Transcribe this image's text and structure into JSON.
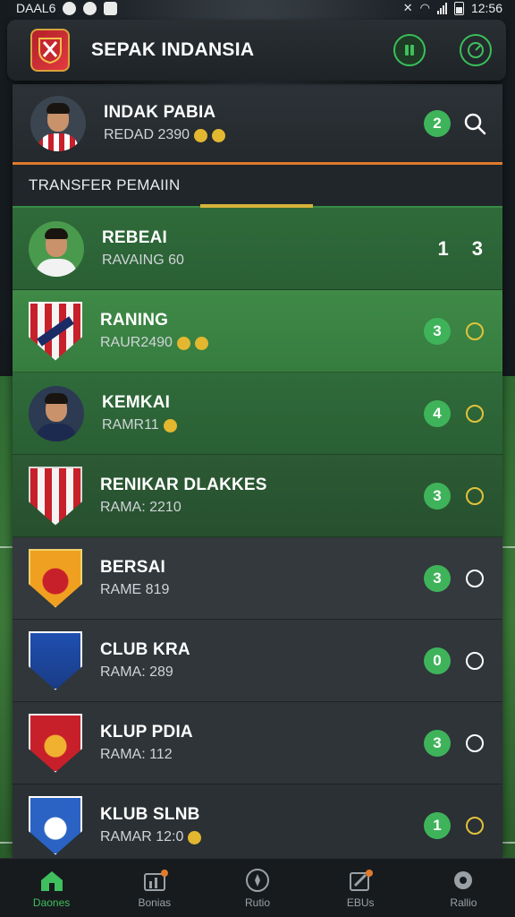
{
  "status_bar": {
    "carrier": "DAAL6",
    "time": "12:56"
  },
  "app": {
    "title": "SEPAK INDANSIA"
  },
  "featured": {
    "name": "INDAK PABIA",
    "sub": "REDAD 2390",
    "badge": "2"
  },
  "section": {
    "title": "TRANSFER PEMAIIN"
  },
  "rows": [
    {
      "name": "REBEAI",
      "sub": "RAVAING 60",
      "badge": "1",
      "action_text": "3",
      "kind": "player",
      "highlight": "green"
    },
    {
      "name": "RANING",
      "sub": "RAUR2490",
      "badge": "3",
      "kind": "crest",
      "highlight": "bright"
    },
    {
      "name": "KEMKAI",
      "sub": "RAMR11",
      "badge": "4",
      "kind": "player",
      "highlight": "green"
    },
    {
      "name": "RENIKAR DLAKKES",
      "sub": "RAMA: 2210",
      "badge": "3",
      "kind": "crest",
      "highlight": "green"
    },
    {
      "name": "BERSAI",
      "sub": "RAME 819",
      "badge": "3",
      "kind": "crest",
      "highlight": "dark"
    },
    {
      "name": "CLUB KRA",
      "sub": "RAMA: 289",
      "badge": "0",
      "kind": "crest",
      "highlight": "dark"
    },
    {
      "name": "KLUP PDIA",
      "sub": "RAMA: 112",
      "badge": "3",
      "kind": "crest",
      "highlight": "dark"
    },
    {
      "name": "KLUB SLNB",
      "sub": "RAMAR 12:0",
      "badge": "1",
      "kind": "crest",
      "highlight": "dark"
    }
  ],
  "nav": [
    {
      "label": "Daones",
      "icon": "home-icon",
      "active": true
    },
    {
      "label": "Bonias",
      "icon": "chart-icon",
      "active": false
    },
    {
      "label": "Rutio",
      "icon": "compass-icon",
      "active": false
    },
    {
      "label": "EBUs",
      "icon": "edit-icon",
      "active": false
    },
    {
      "label": "Rallio",
      "icon": "settings-icon",
      "active": false
    }
  ],
  "colors": {
    "accent": "#3fb35a",
    "gold": "#e1c23c",
    "orange": "#e07a2c"
  }
}
